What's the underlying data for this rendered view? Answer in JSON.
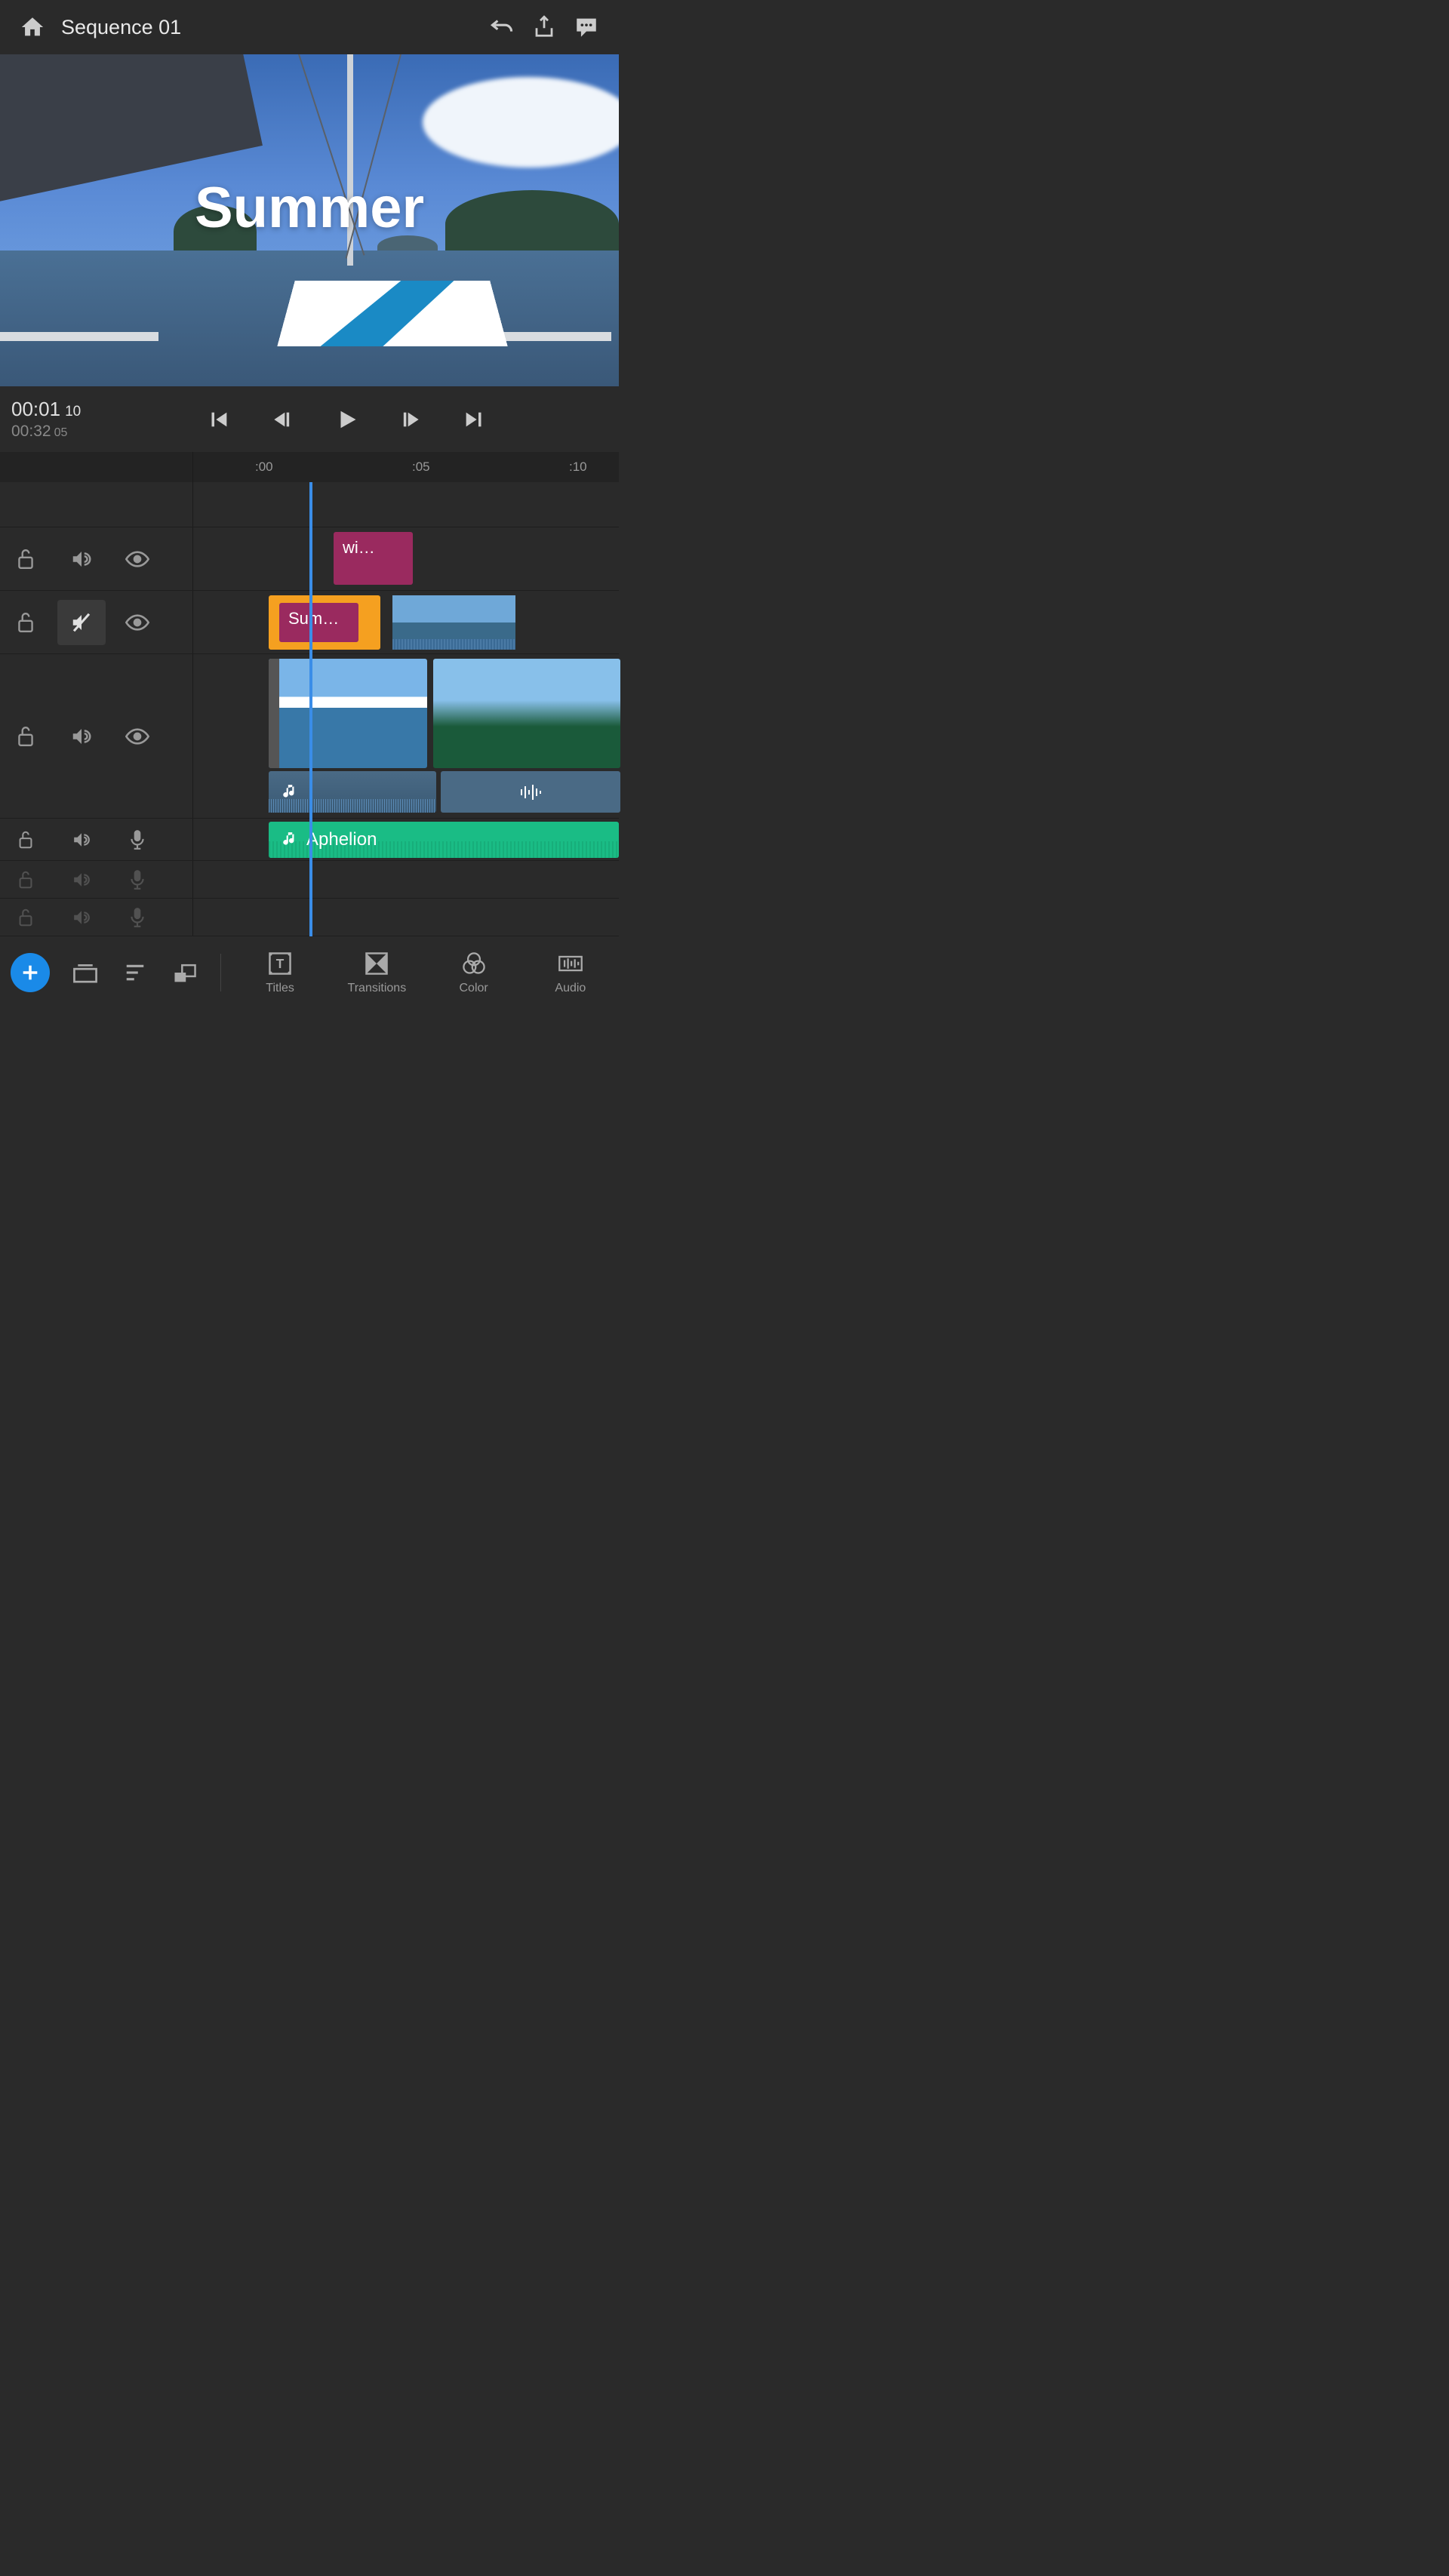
{
  "header": {
    "title": "Sequence 01"
  },
  "preview": {
    "title_overlay": "Summer"
  },
  "playback": {
    "current_time": "00:01",
    "current_frames": "10",
    "duration_time": "00:32",
    "duration_frames": "05"
  },
  "ruler": {
    "marks": [
      ":00",
      ":05",
      ":10"
    ]
  },
  "clips": {
    "title1": "wi…",
    "title2": "Sum…",
    "audio_track": "Aphelion"
  },
  "bottom": {
    "titles": "Titles",
    "transitions": "Transitions",
    "color": "Color",
    "audio": "Audio"
  }
}
